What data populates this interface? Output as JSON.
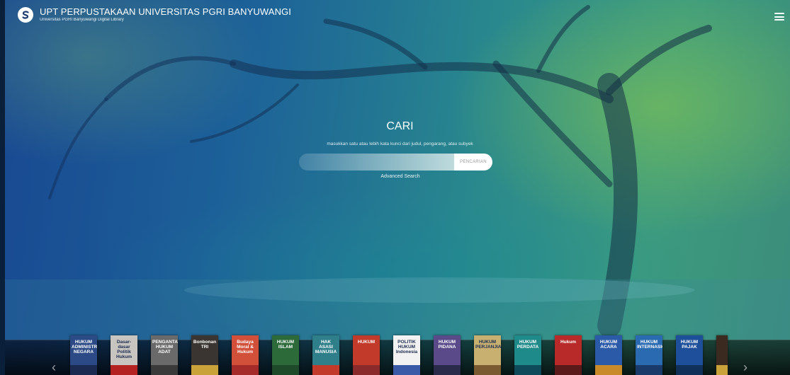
{
  "header": {
    "title": "UPT PERPUSTAKAAN UNIVERSITAS PGRI BANYUWANGI",
    "subtitle": "Universitas PGRI Banyuwangi Digital Library",
    "menu_icon": "hamburger-menu-icon",
    "logo_icon": "library-s-logo"
  },
  "search": {
    "title": "CARI",
    "hint": "masukkan satu atau lebih kata kunci dari judul, pengarang, atau subyek",
    "input_value": "",
    "placeholder": "",
    "button_label": "PENCARIAN",
    "advanced_label": "Advanced Search"
  },
  "carousel": {
    "prev_label": "‹",
    "next_label": "›",
    "books": [
      {
        "cover_text": "HUKUM ADMINISTRASI NEGARA",
        "color": "#2c4a86",
        "band": "#1a2a50"
      },
      {
        "cover_text": "Dasar-dasar Politik Hukum",
        "color": "#c8c4bf",
        "band": "#b52222"
      },
      {
        "cover_text": "PENGANTAR HUKUM ADAT",
        "color": "#6a6a6a",
        "band": "#3a3a3a"
      },
      {
        "cover_text": "Bonbonan TRI",
        "color": "#3a3530",
        "band": "#c9a23a"
      },
      {
        "cover_text": "Budaya Moral & Hukum",
        "color": "#d2503a",
        "band": "#a52a2a"
      },
      {
        "cover_text": "HUKUM ISLAM",
        "color": "#2c6a3a",
        "band": "#1f4a2a"
      },
      {
        "cover_text": "HAK ASASI MANUSIA",
        "color": "#2f7f8a",
        "band": "#c23a2a"
      },
      {
        "cover_text": "HUKUM",
        "color": "#c23a2a",
        "band": "#8a2a2a"
      },
      {
        "cover_text": "POLITIK HUKUM Indonesia",
        "color": "#f2f2f2",
        "band": "#3a5aa8"
      },
      {
        "cover_text": "HUKUM PIDANA",
        "color": "#5a4a8a",
        "band": "#2a2a4a"
      },
      {
        "cover_text": "HUKUM PERJANJIAN",
        "color": "#c8b070",
        "band": "#7a5a30"
      },
      {
        "cover_text": "HUKUM PERDATA",
        "color": "#1f8a8a",
        "band": "#0f4a5a"
      },
      {
        "cover_text": "Hukum",
        "color": "#b82a2a",
        "band": "#5a1a1a"
      },
      {
        "cover_text": "HUKUM ACARA",
        "color": "#2a5aa8",
        "band": "#c98a2a"
      },
      {
        "cover_text": "HUKUM INTERNASIONAL",
        "color": "#2a6ab0",
        "band": "#1a3a6a"
      },
      {
        "cover_text": "HUKUM PAJAK",
        "color": "#1e4f9a",
        "band": "#10305a"
      },
      {
        "cover_text": "",
        "color": "#3a2a20",
        "band": "#c9a23a"
      }
    ]
  }
}
